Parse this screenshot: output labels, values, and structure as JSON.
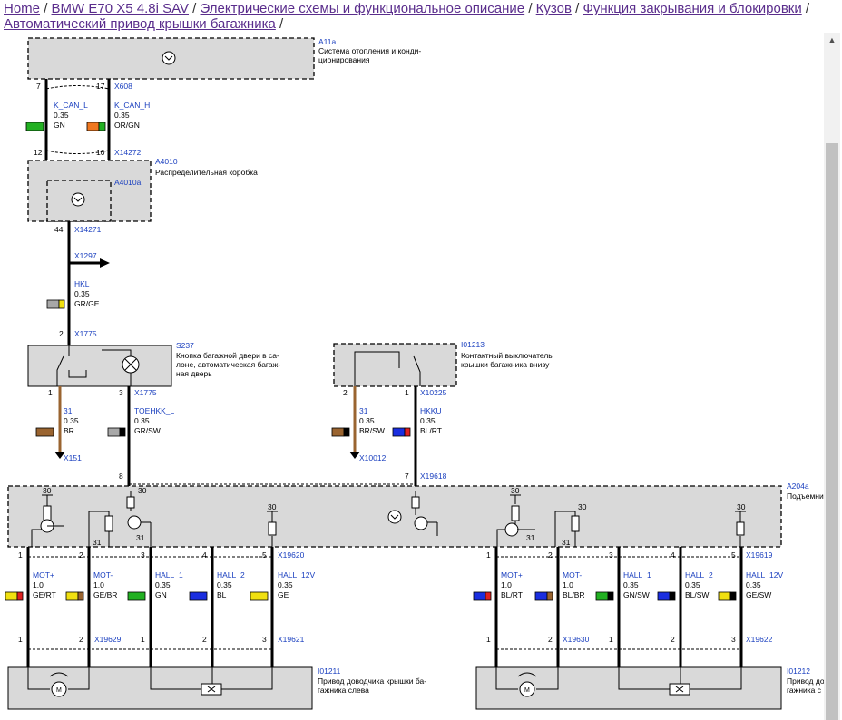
{
  "breadcrumb": {
    "items": [
      "Home",
      "BMW E70 X5 4.8i SAV",
      "Электрические схемы и функциональное описание",
      "Кузов",
      "Функция закрывания и блокировки",
      "Автоматический привод крышки багажника"
    ],
    "separator": "/"
  },
  "components": {
    "a11a": {
      "id": "A11a",
      "desc1": "Система отопления и конди-",
      "desc2": "ционирования"
    },
    "a4010": {
      "id": "A4010",
      "desc": "Распределительная коробка",
      "sub": "A4010a"
    },
    "s237": {
      "id": "S237",
      "desc1": "Кнопка багажной двери в са-",
      "desc2": "лоне, автоматическая багаж-",
      "desc3": "ная дверь"
    },
    "i01213": {
      "id": "I01213",
      "desc1": "Контактный выключатель",
      "desc2": "крышки багажника внизу"
    },
    "a204a": {
      "id": "A204a",
      "desc": "Подъемни"
    },
    "i01211": {
      "id": "I01211",
      "desc1": "Привод доводчика крышки ба-",
      "desc2": "гажника слева"
    },
    "i01212": {
      "id": "I01212",
      "desc1": "Привод до",
      "desc2": "гажника с"
    }
  },
  "connectors": {
    "x608": "X608",
    "x14272": "X14272",
    "x14271": "X14271",
    "x1297": "X1297",
    "x1775a": "X1775",
    "x1775b": "X1775",
    "x151": "X151",
    "x10225": "X10225",
    "x10012": "X10012",
    "x19618": "X19618",
    "x19620": "X19620",
    "x19619": "X19619",
    "x19629": "X19629",
    "x19621": "X19621",
    "x19630": "X19630",
    "x19622": "X19622"
  },
  "pins": {
    "p7": "7",
    "p17": "17",
    "p12": "12",
    "p10": "10",
    "p44": "44",
    "p2s": "2",
    "s237_1": "1",
    "s237_3": "3",
    "i13_2": "2",
    "i13_1": "1",
    "a204_8": "8",
    "a204_7": "7",
    "l1": "1",
    "l2": "2",
    "l3": "3",
    "l4": "4",
    "l5": "5",
    "r1": "1",
    "r2": "2",
    "r3": "3",
    "r4": "4",
    "r5": "5",
    "bl1": "1",
    "bl2": "2",
    "bl3": "1",
    "bl4": "2",
    "bl5": "3",
    "br1": "1",
    "br2": "2",
    "br3": "1",
    "br4": "2",
    "br5": "3",
    "g30a": "30",
    "g31a": "31",
    "g30b": "30",
    "g31b": "31",
    "g30c": "30",
    "g30d": "30",
    "g31c": "31",
    "g30e": "30",
    "g31d": "31",
    "g30f": "30"
  },
  "wires": {
    "kcanl": {
      "name": "K_CAN_L",
      "size": "0.35",
      "color": "GN"
    },
    "kcanh": {
      "name": "K_CAN_H",
      "size": "0.35",
      "color": "OR/GN"
    },
    "hkl": {
      "name": "HKL",
      "size": "0.35",
      "color": "GR/GE"
    },
    "w31a": {
      "name": "31",
      "size": "0.35",
      "color": "BR"
    },
    "toehkk": {
      "name": "TOEHKK_L",
      "size": "0.35",
      "color": "GR/SW"
    },
    "w31b": {
      "name": "31",
      "size": "0.35",
      "color": "BR/SW"
    },
    "hkku": {
      "name": "HKKU",
      "size": "0.35",
      "color": "BL/RT"
    },
    "l_motp": {
      "name": "MOT+",
      "size": "1.0",
      "color": "GE/RT"
    },
    "l_motm": {
      "name": "MOT-",
      "size": "1.0",
      "color": "GE/BR"
    },
    "l_hall1": {
      "name": "HALL_1",
      "size": "0.35",
      "color": "GN"
    },
    "l_hall2": {
      "name": "HALL_2",
      "size": "0.35",
      "color": "BL"
    },
    "l_hall12": {
      "name": "HALL_12V",
      "size": "0.35",
      "color": "GE"
    },
    "r_motp": {
      "name": "MOT+",
      "size": "1.0",
      "color": "BL/RT"
    },
    "r_motm": {
      "name": "MOT-",
      "size": "1.0",
      "color": "BL/BR"
    },
    "r_hall1": {
      "name": "HALL_1",
      "size": "0.35",
      "color": "GN/SW"
    },
    "r_hall2": {
      "name": "HALL_2",
      "size": "0.35",
      "color": "BL/SW"
    },
    "r_hall12": {
      "name": "HALL_12V",
      "size": "0.35",
      "color": "GE/SW"
    }
  },
  "colors": {
    "GN": "#22b022",
    "OR": "#f07820",
    "GR": "#a8a8a8",
    "GE": "#f0e010",
    "BR": "#9a6430",
    "SW": "#000000",
    "BL": "#1a2ee0",
    "RT": "#e02020",
    "link": "#5a2d8c",
    "pin_label": "#1a3fbf",
    "box_fill": "#d9d9d9"
  }
}
